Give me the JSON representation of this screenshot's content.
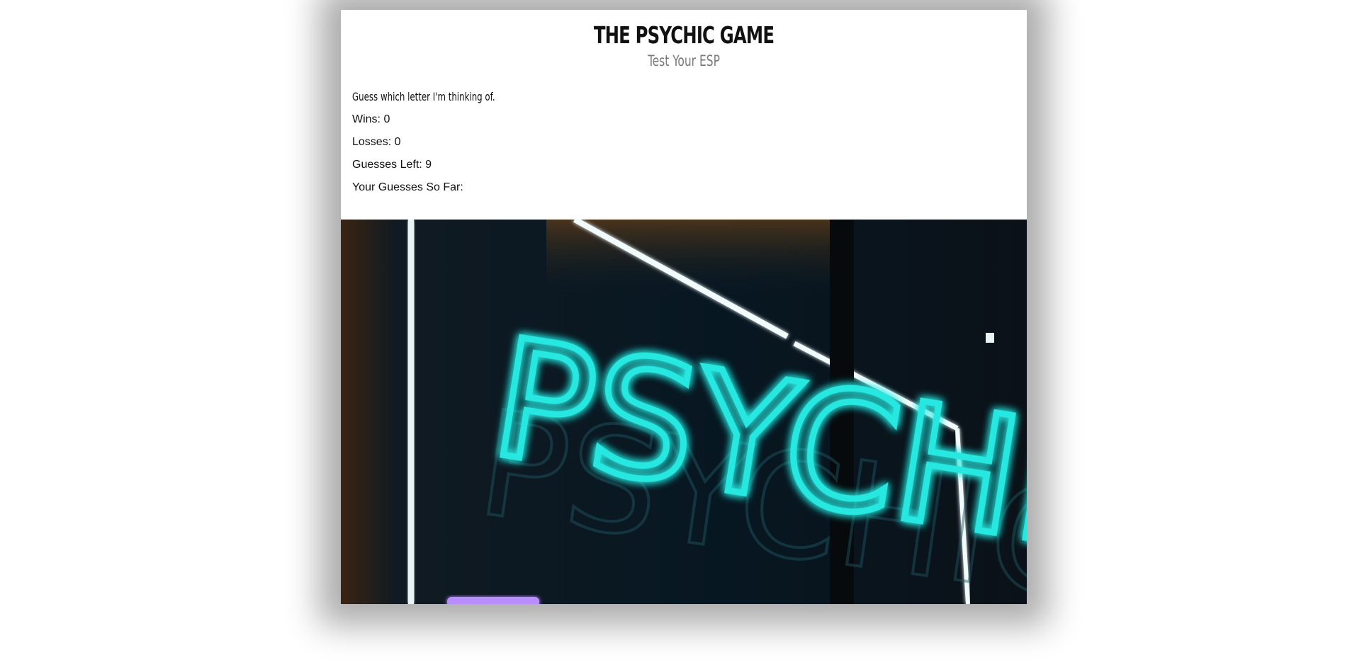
{
  "header": {
    "title": "THE PSYCHIC GAME",
    "subtitle": "Test Your ESP"
  },
  "game": {
    "prompt": "Guess which letter I'm thinking of.",
    "wins_label": "Wins: ",
    "wins": "0",
    "losses_label": "Losses: ",
    "losses": "0",
    "guesses_left_label": "Guesses Left: ",
    "guesses_left": "9",
    "guesses_so_far_label": "Your Guesses So Far:",
    "guesses_so_far": ""
  },
  "hero_image": {
    "sign_text": "PSYCHIC",
    "neon_color": "#26e8e0",
    "background_color": "#06121a"
  }
}
